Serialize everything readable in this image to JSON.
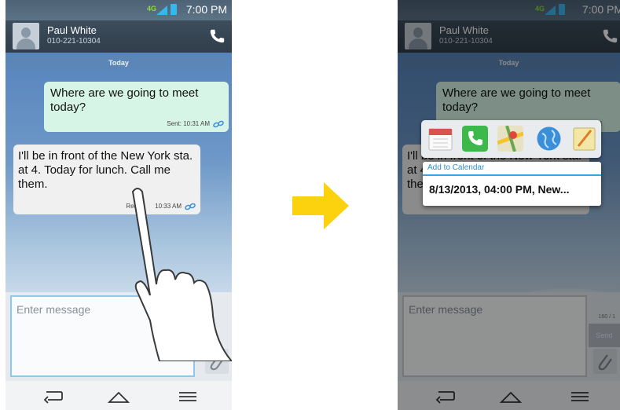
{
  "status": {
    "network": "4G",
    "time": "7:00 PM"
  },
  "contact": {
    "name": "Paul White",
    "number": "010-221-10304"
  },
  "conversation": {
    "date": "Today",
    "sent": {
      "text": "Where are we going to meet today?",
      "meta": "Sent: 10:31 AM"
    },
    "received": {
      "text": "I'll be in front of the New York sta. at 4. Today for lunch. Call me them.",
      "meta_left": "Rece",
      "meta_right": "10:33 AM"
    }
  },
  "compose": {
    "placeholder": "Enter message",
    "counter": "160 / 1",
    "send_label": "Send"
  },
  "popup": {
    "apps": [
      "calendar-icon",
      "phone-icon",
      "maps-icon",
      "browser-icon",
      "memo-icon"
    ],
    "action_label": "Add to Calendar",
    "detected_value": "8/13/2013, 04:00 PM, New..."
  },
  "nav": {
    "items": [
      "back-icon",
      "home-icon",
      "menu-icon"
    ]
  },
  "colors": {
    "accent": "#36a6e0",
    "arrow": "#fcd20f",
    "sent_bubble": "#d6f5e6"
  }
}
